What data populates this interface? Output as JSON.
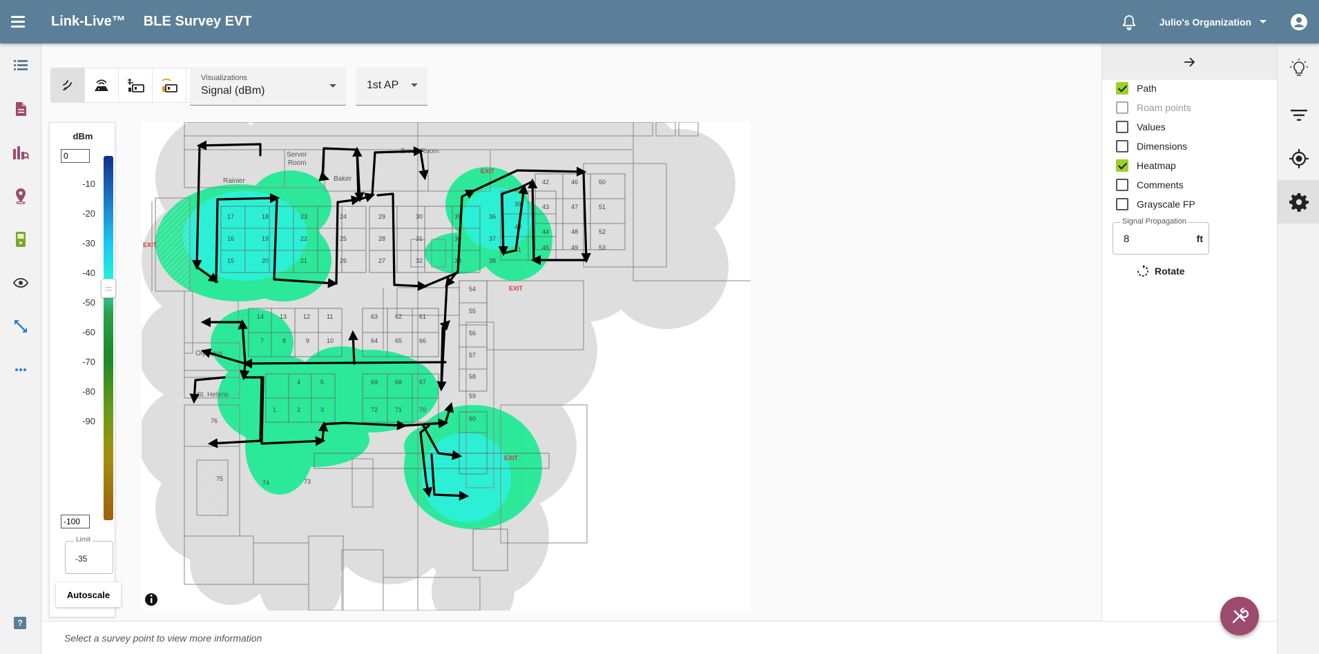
{
  "appbar": {
    "brand": "Link-Live™",
    "title": "BLE Survey EVT",
    "organization": "Julio's Organization"
  },
  "toolbar": {
    "visualizations_label": "Visualizations",
    "visualizations_value": "Signal (dBm)",
    "ap_value": "1st AP"
  },
  "legend": {
    "unit": "dBm",
    "max_value": "0",
    "min_value": "-100",
    "ticks": [
      "-10",
      "-20",
      "-30",
      "-40",
      "-50",
      "-60",
      "-70",
      "-80",
      "-90"
    ],
    "limit_label": "Limit",
    "limit_value": "-35",
    "autoscale_label": "Autoscale",
    "slider_level_dbm": -35
  },
  "map": {
    "rooms": {
      "server": "Server",
      "server2": "Room",
      "breakroom": "Break Room",
      "rainier": "Rainier",
      "baker": "Baker",
      "olympus": "Olympus",
      "helens": "St. Helens",
      "exit": "EXIT"
    },
    "desks": [
      "17",
      "18",
      "23",
      "24",
      "29",
      "30",
      "35",
      "36",
      "16",
      "19",
      "22",
      "25",
      "28",
      "31",
      "34",
      "37",
      "15",
      "20",
      "21",
      "26",
      "27",
      "32",
      "33",
      "38",
      "39",
      "40",
      "41",
      "42",
      "43",
      "44",
      "45",
      "46",
      "47",
      "48",
      "49",
      "50",
      "51",
      "52",
      "53",
      "54",
      "55",
      "56",
      "57",
      "58",
      "59",
      "60",
      "14",
      "13",
      "12",
      "11",
      "7",
      "8",
      "9",
      "10",
      "63",
      "62",
      "61",
      "64",
      "65",
      "66",
      "4",
      "5",
      "69",
      "68",
      "67",
      "1",
      "2",
      "3",
      "72",
      "71",
      "70",
      "76",
      "75",
      "74",
      "73"
    ]
  },
  "layers": {
    "items": [
      {
        "label": "Path",
        "checked": true,
        "disabled": false
      },
      {
        "label": "Roam points",
        "checked": false,
        "disabled": true
      },
      {
        "label": "Values",
        "checked": false,
        "disabled": false
      },
      {
        "label": "Dimensions",
        "checked": false,
        "disabled": false
      },
      {
        "label": "Heatmap",
        "checked": true,
        "disabled": false
      },
      {
        "label": "Comments",
        "checked": false,
        "disabled": false
      },
      {
        "label": "Grayscale FP",
        "checked": false,
        "disabled": false
      }
    ],
    "propagation_label": "Signal Propagation",
    "propagation_value": "8",
    "propagation_unit": "ft",
    "rotate_label": "Rotate"
  },
  "status": {
    "message": "Select a survey point to view more information"
  },
  "icons": {
    "menu": "menu-icon",
    "bell": "bell-icon",
    "account": "account-icon",
    "lightbulb": "lightbulb-icon",
    "filter": "filter-icon",
    "target": "target-icon",
    "gear": "gear-icon",
    "tools": "tools-icon"
  },
  "colors": {
    "appbar": "#5b7f98",
    "accent_check": "#9dd12a",
    "fab": "#9c4a6d",
    "heat_cyan": "#2cf0d8",
    "heat_green": "#22ea96",
    "nav_icon": "#9c4a6d"
  }
}
